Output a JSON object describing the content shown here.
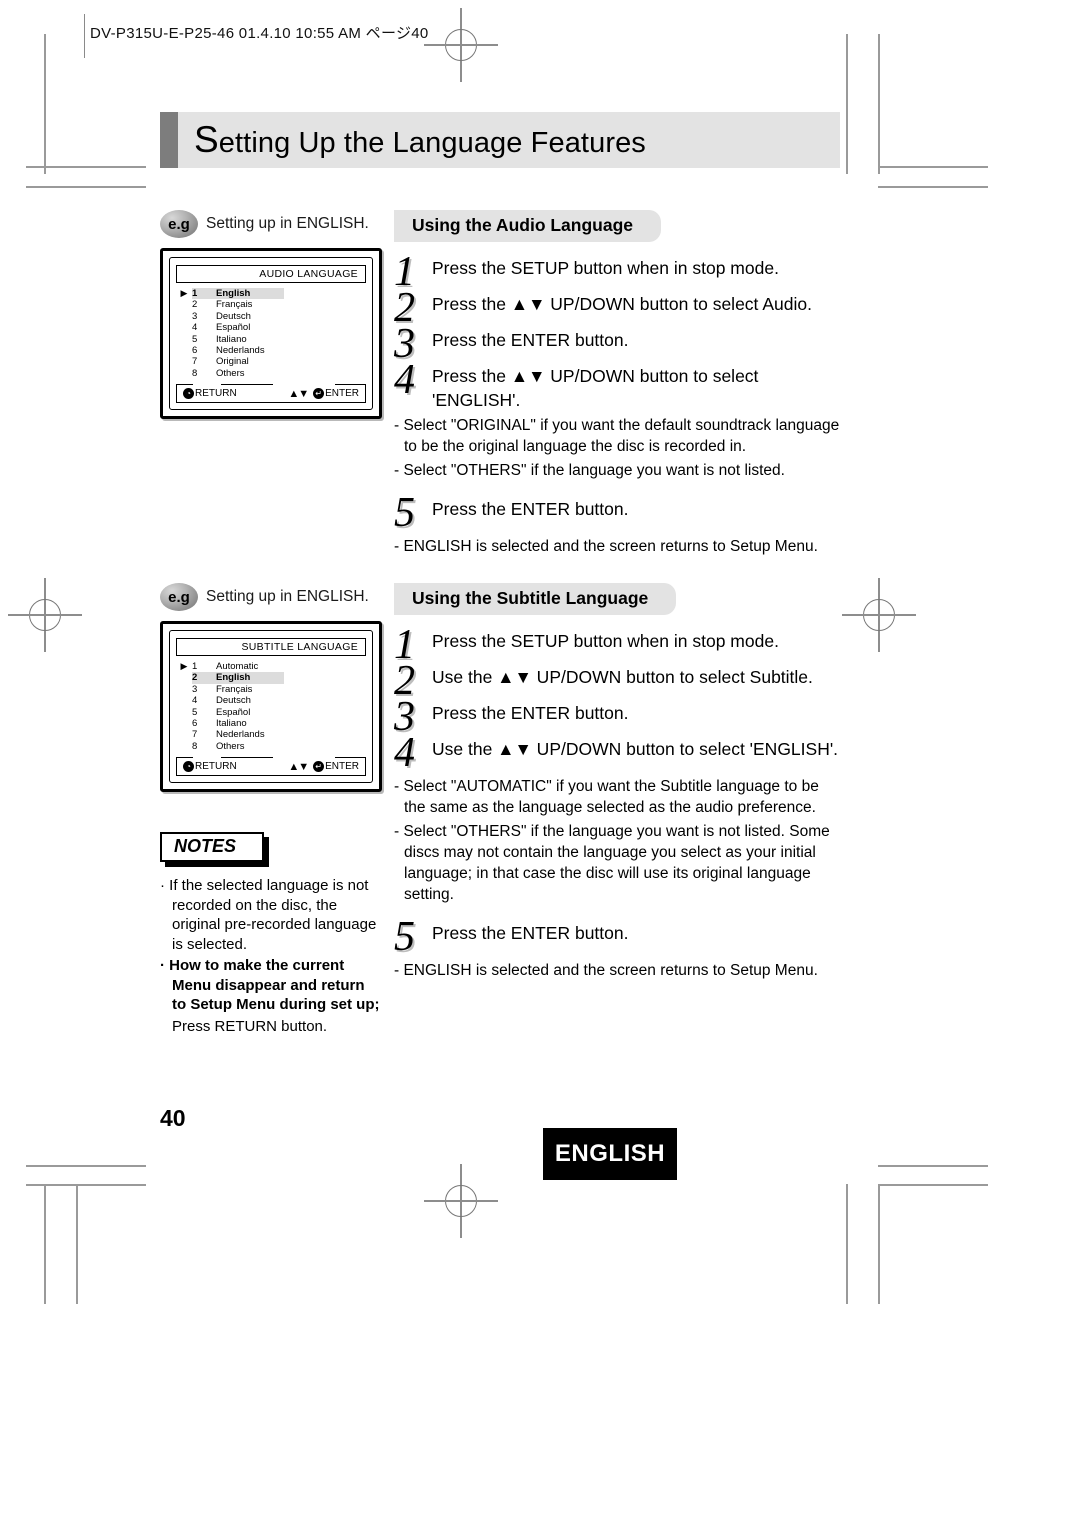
{
  "header": {
    "slug": "DV-P315U-E-P25-46  01.4.10 10:55 AM  ページ40"
  },
  "title": {
    "initial": "S",
    "rest": "etting Up the Language Features"
  },
  "audio_example": {
    "badge": "e.g",
    "caption": "Setting up in ENGLISH.",
    "screen_title": "AUDIO LANGUAGE",
    "items": [
      {
        "num": "1",
        "label": "English",
        "caret": "▶",
        "selected": true
      },
      {
        "num": "2",
        "label": "Français",
        "caret": "",
        "selected": false
      },
      {
        "num": "3",
        "label": "Deutsch",
        "caret": "",
        "selected": false
      },
      {
        "num": "4",
        "label": "Español",
        "caret": "",
        "selected": false
      },
      {
        "num": "5",
        "label": "Italiano",
        "caret": "",
        "selected": false
      },
      {
        "num": "6",
        "label": "Nederlands",
        "caret": "",
        "selected": false
      },
      {
        "num": "7",
        "label": "Original",
        "caret": "",
        "selected": false
      },
      {
        "num": "8",
        "label": "Others",
        "caret": "",
        "selected": false
      }
    ],
    "footer": {
      "return_label": "RETURN",
      "return_icon": "◔",
      "updown_icon": "▲▼",
      "enter_icon": "↵",
      "enter_label": "ENTER"
    }
  },
  "subtitle_example": {
    "badge": "e.g",
    "caption": "Setting up in ENGLISH.",
    "screen_title": "SUBTITLE LANGUAGE",
    "items": [
      {
        "num": "1",
        "label": "Automatic",
        "caret": "▶",
        "selected": false
      },
      {
        "num": "2",
        "label": "English",
        "caret": "",
        "selected": true
      },
      {
        "num": "3",
        "label": "Français",
        "caret": "",
        "selected": false
      },
      {
        "num": "4",
        "label": "Deutsch",
        "caret": "",
        "selected": false
      },
      {
        "num": "5",
        "label": "Español",
        "caret": "",
        "selected": false
      },
      {
        "num": "6",
        "label": "Italiano",
        "caret": "",
        "selected": false
      },
      {
        "num": "7",
        "label": "Nederlands",
        "caret": "",
        "selected": false
      },
      {
        "num": "8",
        "label": "Others",
        "caret": "",
        "selected": false
      }
    ],
    "footer": {
      "return_label": "RETURN",
      "return_icon": "◔",
      "updown_icon": "▲▼",
      "enter_icon": "↵",
      "enter_label": "ENTER"
    }
  },
  "audio_section": {
    "heading": "Using the Audio Language",
    "step1_num": "1",
    "step1_text": "Press the SETUP button when in stop mode.",
    "step2_num": "2",
    "step2_text": "Press the ▲▼ UP/DOWN button to select Audio.",
    "step3_num": "3",
    "step3_text": "Press the ENTER button.",
    "step4_num": "4",
    "step4_text": "Press the ▲▼ UP/DOWN button to select 'ENGLISH'.",
    "note1": "- Select \"ORIGINAL\" if you want the default soundtrack language to be the original language the disc is recorded in.",
    "note2": "- Select \"OTHERS\" if the language you want is not listed.",
    "step5_num": "5",
    "step5_text": "Press the ENTER button.",
    "note3": "- ENGLISH is selected and the screen returns to Setup Menu."
  },
  "subtitle_section": {
    "heading": "Using the Subtitle Language",
    "step1_num": "1",
    "step1_text": "Press the SETUP button when in stop mode.",
    "step2_num": "2",
    "step2_text": "Use the ▲▼ UP/DOWN button to select Subtitle.",
    "step3_num": "3",
    "step3_text": "Press the ENTER button.",
    "step4_num": "4",
    "step4_text": "Use the ▲▼ UP/DOWN button to select 'ENGLISH'.",
    "note1": "- Select \"AUTOMATIC\" if you want the Subtitle language to be the same as the language selected as the audio preference.",
    "note2": "- Select \"OTHERS\" if the language you want is not listed. Some discs may not contain the language you select as your initial language; in that case the disc will use its original   language setting.",
    "step5_num": "5",
    "step5_text": "Press the ENTER button.",
    "note3": "- ENGLISH is selected and the screen returns to Setup Menu."
  },
  "notes": {
    "tag": "NOTES",
    "bullet1": "· If the selected language is not recorded on the disc, the original pre-recorded language is selected.",
    "bullet2": "· How to make the current Menu disappear and return to Setup Menu during set up;",
    "bullet2_sub": "Press RETURN button."
  },
  "footer": {
    "page_number": "40",
    "language_badge": "ENGLISH"
  }
}
